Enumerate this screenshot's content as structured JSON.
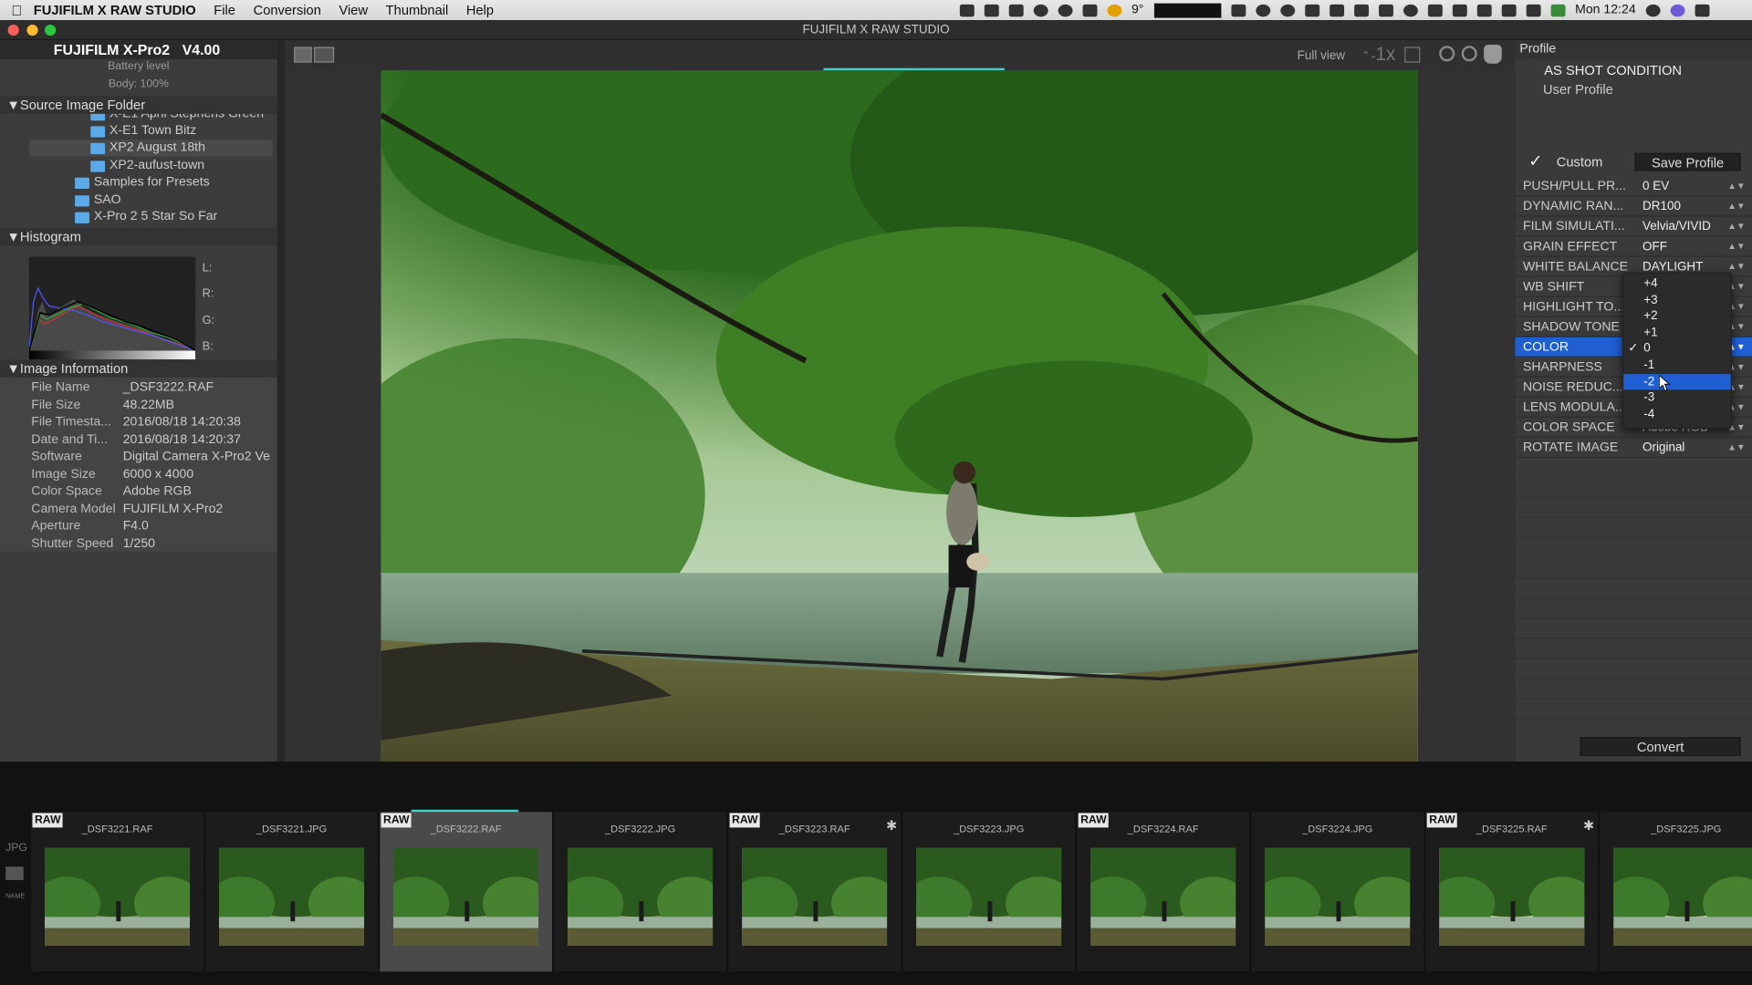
{
  "menubar": {
    "apple": "",
    "app_name": "FUJIFILM X RAW STUDIO",
    "items": [
      "File",
      "Conversion",
      "View",
      "Thumbnail",
      "Help"
    ],
    "temperature": "9°",
    "clock": "Mon 12:24"
  },
  "window": {
    "title": "FUJIFILM X RAW STUDIO"
  },
  "camera": {
    "model": "FUJIFILM X-Pro2",
    "version": "V4.00",
    "battery_label": "Battery level",
    "body": "Body: 100%"
  },
  "source_folder": {
    "header": "▼Source Image Folder",
    "folders": [
      "X-E1 April Stephens Green",
      "X-E1 Town Bitz",
      "XP2 August 18th",
      "XP2-aufust-town",
      "Samples for Presets",
      "SAO",
      "X-Pro 2 5 Star So Far"
    ]
  },
  "histogram": {
    "header": "▼Histogram",
    "labels": [
      "L:",
      "R:",
      "G:",
      "B:"
    ]
  },
  "image_info": {
    "header": "▼Image Information",
    "rows": [
      {
        "key": "File Name",
        "value": "_DSF3222.RAF"
      },
      {
        "key": "File Size",
        "value": "48.22MB"
      },
      {
        "key": "File Timesta...",
        "value": "2016/08/18 14:20:38"
      },
      {
        "key": "Date and Ti...",
        "value": "2016/08/18 14:20:37"
      },
      {
        "key": "Software",
        "value": "Digital Camera X-Pro2 Ve"
      },
      {
        "key": "Image Size",
        "value": "6000 x 4000"
      },
      {
        "key": "Color Space",
        "value": "Adobe RGB"
      },
      {
        "key": "Camera Model",
        "value": "FUJIFILM X-Pro2"
      },
      {
        "key": "Aperture",
        "value": "F4.0"
      },
      {
        "key": "Shutter Speed",
        "value": "1/250"
      }
    ]
  },
  "viewer": {
    "view_mode": "Full view",
    "zoom_label": "1x"
  },
  "profile": {
    "header": "Profile",
    "as_shot": "AS SHOT CONDITION",
    "user_profile": "User Profile",
    "custom_label": "Custom",
    "save_button": "Save Profile",
    "convert_button": "Convert",
    "params": [
      {
        "key": "PUSH/PULL PR...",
        "value": "0 EV"
      },
      {
        "key": "DYNAMIC RAN...",
        "value": "DR100"
      },
      {
        "key": "FILM SIMULATI...",
        "value": "Velvia/VIVID"
      },
      {
        "key": "GRAIN EFFECT",
        "value": "OFF"
      },
      {
        "key": "WHITE BALANCE",
        "value": "DAYLIGHT"
      },
      {
        "key": "WB SHIFT",
        "value": ""
      },
      {
        "key": "HIGHLIGHT TO...",
        "value": ""
      },
      {
        "key": "SHADOW TONE",
        "value": ""
      },
      {
        "key": "COLOR",
        "value": ""
      },
      {
        "key": "SHARPNESS",
        "value": ""
      },
      {
        "key": "NOISE REDUC...",
        "value": ""
      },
      {
        "key": "LENS MODULA...",
        "value": ""
      },
      {
        "key": "COLOR SPACE",
        "value": "Adobe RGB"
      },
      {
        "key": "ROTATE IMAGE",
        "value": "Original"
      }
    ],
    "selected_param": "COLOR"
  },
  "color_dropdown": {
    "options": [
      "+4",
      "+3",
      "+2",
      "+1",
      "0",
      "-1",
      "-2",
      "-3",
      "-4"
    ],
    "checked": "0",
    "highlighted": "-2",
    "checkmark": "✓"
  },
  "filmstrip": {
    "side_labels": [
      "JPG",
      "NAME"
    ],
    "raw_badge": "RAW",
    "thumbs": [
      {
        "name": "_DSF3221.RAF",
        "raw": true,
        "star": false
      },
      {
        "name": "_DSF3221.JPG",
        "raw": false,
        "star": false
      },
      {
        "name": "_DSF3222.RAF",
        "raw": true,
        "star": false
      },
      {
        "name": "_DSF3222.JPG",
        "raw": false,
        "star": false
      },
      {
        "name": "_DSF3223.RAF",
        "raw": true,
        "star": true
      },
      {
        "name": "_DSF3223.JPG",
        "raw": false,
        "star": false
      },
      {
        "name": "_DSF3224.RAF",
        "raw": true,
        "star": false
      },
      {
        "name": "_DSF3224.JPG",
        "raw": false,
        "star": false
      },
      {
        "name": "_DSF3225.RAF",
        "raw": true,
        "star": true
      },
      {
        "name": "_DSF3225.JPG",
        "raw": false,
        "star": false
      }
    ],
    "current_index": 2,
    "star_glyph": "✱"
  },
  "colors": {
    "accent_blue": "#1f5fd2",
    "teal_indicator": "#3fd3c0",
    "folder_blue": "#5aa9e8"
  }
}
